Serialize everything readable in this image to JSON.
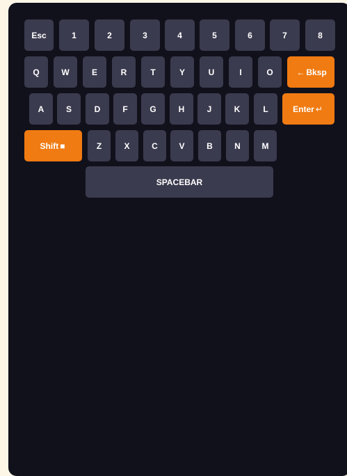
{
  "colors": {
    "page_background": "#fdf6e7",
    "panel_background": "#11111c",
    "key_background": "#3b3b4f",
    "accent": "#f07b12",
    "key_text": "#ffffff"
  },
  "keyboard": {
    "row1": [
      "Esc",
      "1",
      "2",
      "3",
      "4",
      "5",
      "6",
      "7",
      "8"
    ],
    "row2": [
      "Q",
      "W",
      "E",
      "R",
      "T",
      "Y",
      "U",
      "I",
      "O"
    ],
    "row3": [
      "A",
      "S",
      "D",
      "F",
      "G",
      "H",
      "J",
      "K",
      "L"
    ],
    "row4": [
      "Z",
      "X",
      "C",
      "V",
      "B",
      "N",
      "M"
    ],
    "backspace": {
      "glyph": "←",
      "label": "Bksp",
      "icon": "left-arrow-icon"
    },
    "enter": {
      "label": "Enter",
      "glyph": "↵",
      "icon": "return-arrow-icon"
    },
    "shift": {
      "label": "Shift",
      "glyph": "■",
      "icon": "square-icon"
    },
    "spacebar": "SPACEBAR"
  }
}
